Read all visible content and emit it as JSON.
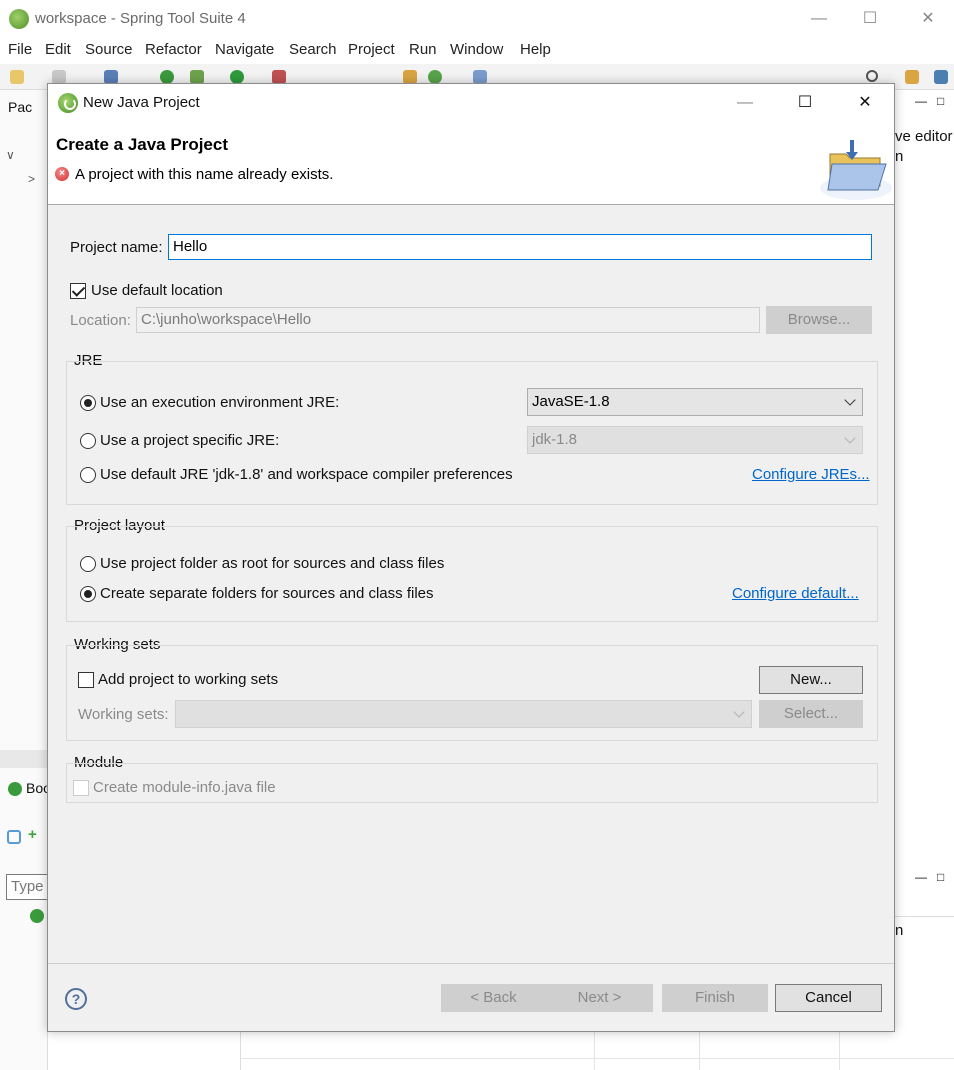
{
  "ide": {
    "title": "workspace - Spring Tool Suite 4",
    "menu": [
      "File",
      "Edit",
      "Source",
      "Refactor",
      "Navigate",
      "Search",
      "Project",
      "Run",
      "Window",
      "Help"
    ],
    "left_panel_tab": "Pac",
    "boot_panel_tab": "Boo",
    "type_filter_placeholder": "Type",
    "right_panel_text": "ve editor",
    "right_panel_text2": "n",
    "bottom_col_text": "n"
  },
  "dialog": {
    "title": "New Java Project",
    "banner_title": "Create a Java Project",
    "error_message": "A project with this name already exists.",
    "project_name_label": "Project name:",
    "project_name_value": "Hello",
    "use_default_location_label": "Use default location",
    "use_default_location_checked": true,
    "location_label": "Location:",
    "location_value": "C:\\junho\\workspace\\Hello",
    "browse_label": "Browse...",
    "jre": {
      "title": "JRE",
      "option_exec_env": "Use an execution environment JRE:",
      "exec_env_value": "JavaSE-1.8",
      "option_project_specific": "Use a project specific JRE:",
      "project_specific_value": "jdk-1.8",
      "option_default": "Use default JRE 'jdk-1.8' and workspace compiler preferences",
      "configure_link": "Configure JREs...",
      "selected": "exec_env"
    },
    "layout": {
      "title": "Project layout",
      "option_root": "Use project folder as root for sources and class files",
      "option_separate": "Create separate folders for sources and class files",
      "configure_link": "Configure default...",
      "selected": "separate"
    },
    "working_sets": {
      "title": "Working sets",
      "add_label": "Add project to working sets",
      "add_checked": false,
      "new_label": "New...",
      "sets_label": "Working sets:",
      "select_label": "Select..."
    },
    "module": {
      "title": "Module",
      "create_label": "Create module-info.java file",
      "create_checked": false
    },
    "buttons": {
      "help": "?",
      "back": "< Back",
      "next": "Next >",
      "finish": "Finish",
      "cancel": "Cancel"
    }
  }
}
